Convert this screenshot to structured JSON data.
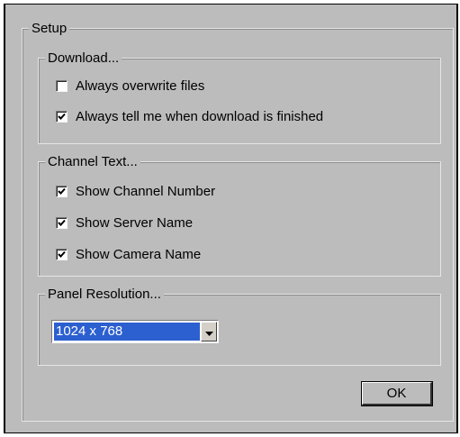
{
  "setup": {
    "legend": "Setup",
    "download": {
      "legend": "Download...",
      "options": [
        {
          "label": "Always overwrite files",
          "checked": false
        },
        {
          "label": "Always tell me when download is finished",
          "checked": true
        }
      ]
    },
    "channel_text": {
      "legend": "Channel Text...",
      "options": [
        {
          "label": "Show Channel Number",
          "checked": true
        },
        {
          "label": "Show Server Name",
          "checked": true
        },
        {
          "label": "Show Camera Name",
          "checked": true
        }
      ]
    },
    "panel_resolution": {
      "legend": "Panel Resolution...",
      "selected": "1024 x 768"
    }
  },
  "ok_label": "OK"
}
